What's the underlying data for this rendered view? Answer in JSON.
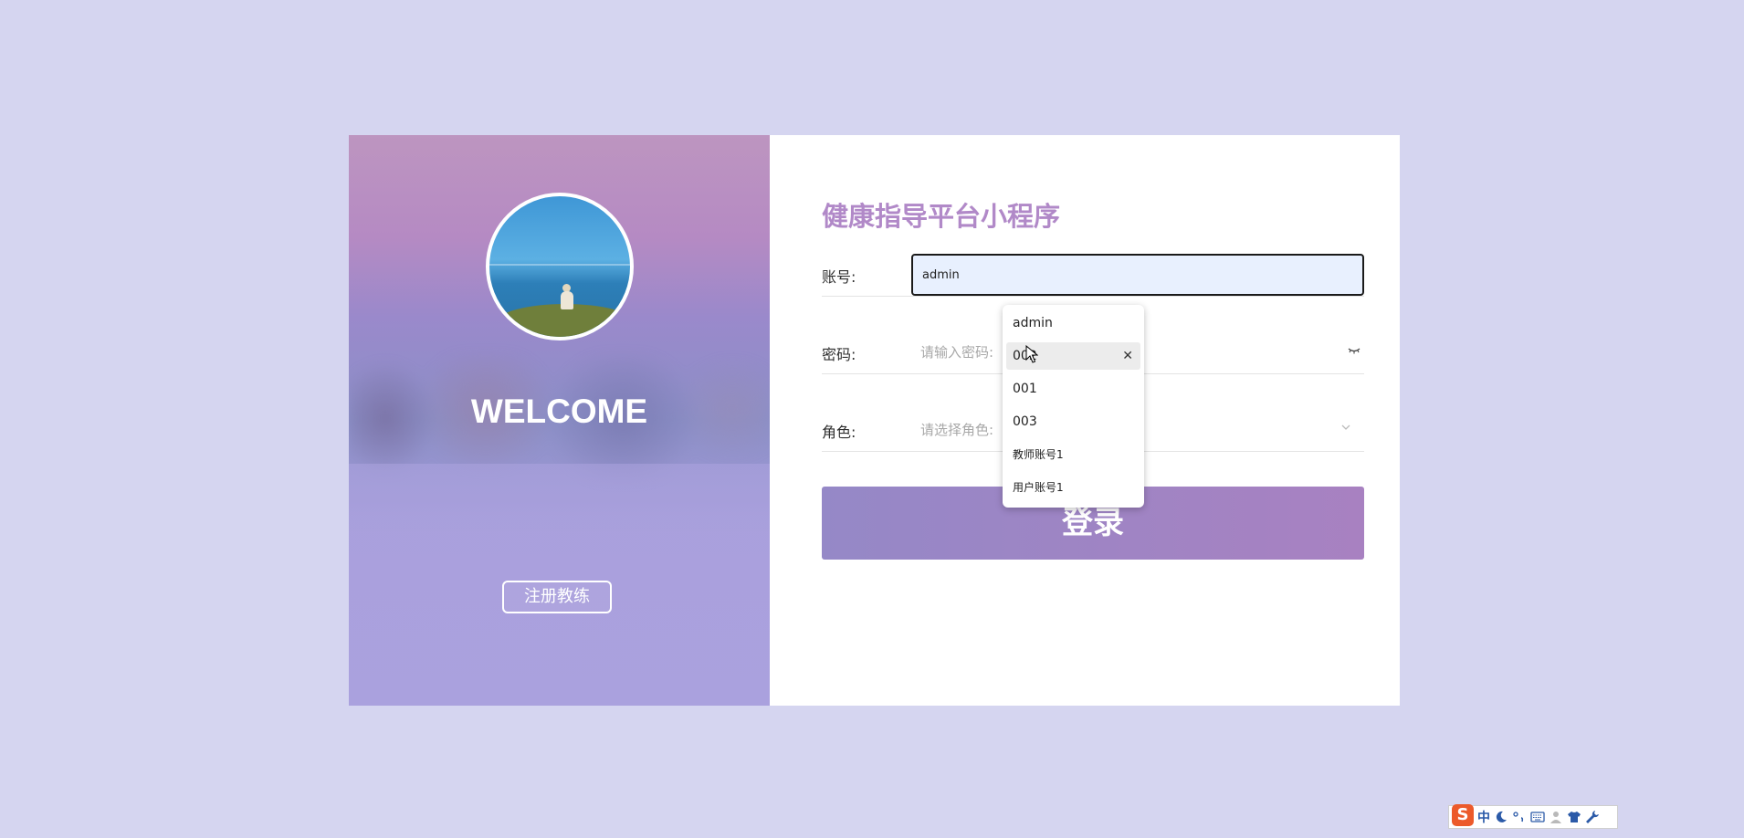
{
  "left_panel": {
    "welcome": "WELCOME",
    "register_button": "注册教练"
  },
  "form": {
    "title": "健康指导平台小程序",
    "account_label": "账号:",
    "account_value": "admin",
    "password_label": "密码:",
    "password_placeholder": "请输入密码:",
    "role_label": "角色:",
    "role_placeholder": "请选择角色:",
    "login_button": "登录"
  },
  "autocomplete": {
    "items": [
      "admin",
      "002",
      "001",
      "003",
      "教师账号1",
      "用户账号1"
    ]
  },
  "ime_toolbar": {
    "logo": "S",
    "mode": "中"
  },
  "colors": {
    "background": "#d5d5f0",
    "title": "#b189c8",
    "login_start": "#9588c7",
    "login_end": "#a881c1",
    "ime_logo": "#ec5a2a"
  }
}
